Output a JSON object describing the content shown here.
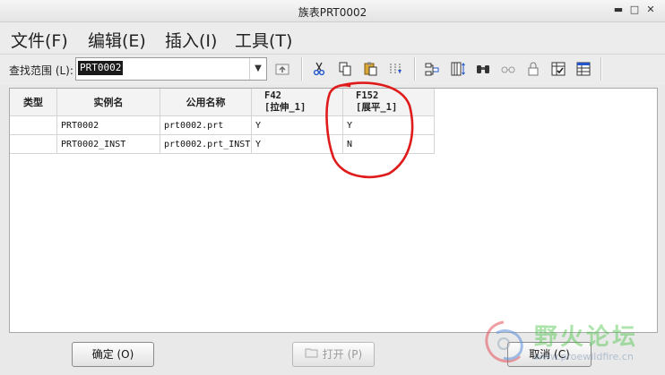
{
  "window": {
    "title": "族表PRT0002"
  },
  "menu": [
    {
      "label": "文件(F)"
    },
    {
      "label": "编辑(E)"
    },
    {
      "label": "插入(I)"
    },
    {
      "label": "工具(T)"
    }
  ],
  "toolbar": {
    "lookin_label": "查找范围 (L):",
    "lookin_value": "PRT0002",
    "icons": [
      "up-folder-icon",
      "cut-icon",
      "copy-icon",
      "paste-icon",
      "insert-column-icon",
      "add-items-icon",
      "column-height-icon",
      "find-icon",
      "glasses-icon",
      "lock-icon",
      "verify-icon",
      "table-icon"
    ]
  },
  "grid": {
    "columns": [
      {
        "label": "类型"
      },
      {
        "label": "实例名"
      },
      {
        "label": "公用名称"
      },
      {
        "label_line1": "F42",
        "label_line2": "[拉伸_1]"
      },
      {
        "label_line1": "F152",
        "label_line2": "[展平_1]"
      }
    ],
    "rows": [
      {
        "type": "",
        "instance": "PRT0002",
        "common": "prt0002.prt",
        "f42": "Y",
        "f152": "Y"
      },
      {
        "type": "",
        "instance": "PRT0002_INST",
        "common": "prt0002.prt_INST",
        "f42": "Y",
        "f152": "N"
      }
    ]
  },
  "buttons": {
    "ok": "确定 (O)",
    "open": "打开 (P)",
    "cancel": "取消 (C)"
  },
  "watermark": {
    "text": "野火论坛",
    "url": "www.proewildfire.cn"
  },
  "colors": {
    "annotation": "#e01b1b",
    "selection": "#1a1a1a"
  }
}
